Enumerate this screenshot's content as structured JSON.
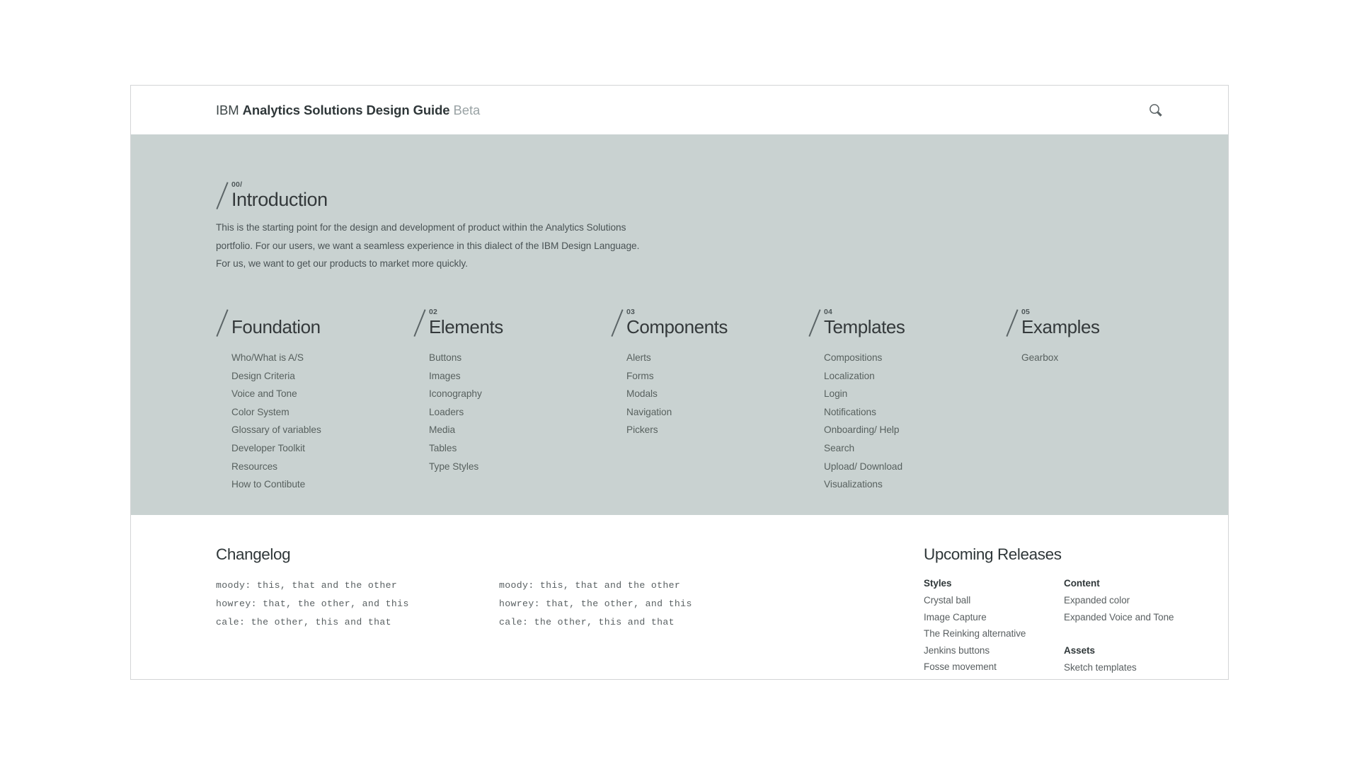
{
  "masthead": {
    "brand_ibm": "IBM",
    "brand_main": "Analytics Solutions Design Guide",
    "brand_beta": "Beta",
    "search_icon": "search-icon"
  },
  "hero": {
    "intro": {
      "number": "00/",
      "title": "Introduction",
      "body": "This is the starting point for the design and development of product within the Analytics Solutions portfolio. For our users, we want a seamless experience in this dialect of the IBM Design Language. For us, we want to get our products to market more quickly."
    },
    "columns": [
      {
        "number": "",
        "title": "Foundation",
        "items": [
          "Who/What is A/S",
          "Design Criteria",
          "Voice and Tone",
          "Color System",
          "Glossary of variables",
          "Developer Toolkit",
          "Resources",
          "How to Contibute"
        ]
      },
      {
        "number": "02",
        "title": "Elements",
        "items": [
          "Buttons",
          "Images",
          "Iconography",
          "Loaders",
          "Media",
          "Tables",
          "Type Styles"
        ]
      },
      {
        "number": "03",
        "title": "Components",
        "items": [
          "Alerts",
          "Forms",
          "Modals",
          "Navigation",
          "Pickers"
        ]
      },
      {
        "number": "04",
        "title": "Templates",
        "items": [
          "Compositions",
          "Localization",
          "Login",
          "Notifications",
          "Onboarding/ Help",
          "Search",
          "Upload/ Download",
          "Visualizations"
        ]
      },
      {
        "number": "05",
        "title": "Examples",
        "items": [
          "Gearbox"
        ]
      }
    ]
  },
  "changelog": {
    "title": "Changelog",
    "columns": [
      [
        "moody: this, that and the other",
        "howrey: that, the other, and this",
        "cale: the other, this and that"
      ],
      [
        "moody: this, that and the other",
        "howrey: that, the other, and this",
        "cale: the other, this and that"
      ]
    ]
  },
  "upcoming": {
    "title": "Upcoming Releases",
    "columns": [
      {
        "groups": [
          {
            "heading": "Styles",
            "items": [
              "Crystal ball",
              "Image Capture",
              "The Reinking alternative",
              "Jenkins buttons",
              "Fosse movement"
            ]
          }
        ]
      },
      {
        "groups": [
          {
            "heading": "Content",
            "items": [
              "Expanded color",
              "Expanded Voice and Tone"
            ]
          },
          {
            "heading": "Assets",
            "items": [
              "Sketch templates"
            ]
          }
        ]
      }
    ]
  },
  "colors": {
    "page_background": "#ffffff",
    "hero_background": "#c9d2d1",
    "card_border": "#d3d5d6",
    "heading_text": "#2f3739",
    "body_text": "#58615f",
    "muted_text": "#9aa3a5"
  }
}
